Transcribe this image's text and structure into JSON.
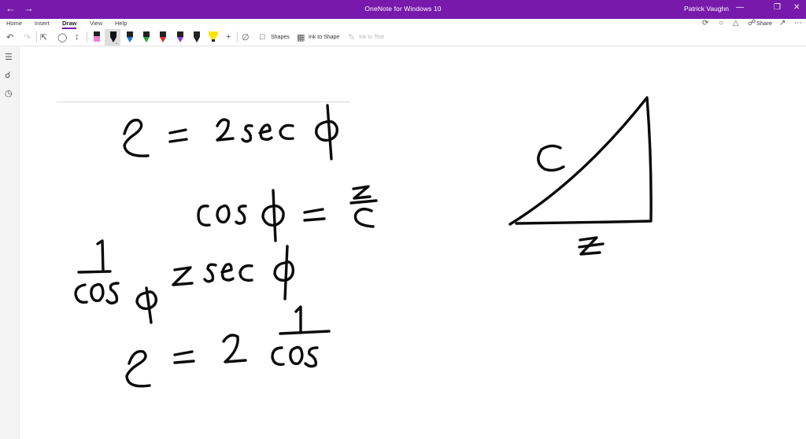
{
  "window": {
    "title": "OneNote for Windows 10",
    "user": "Patrick Vaughn",
    "titlebar_color": "#7719aa"
  },
  "tabs": [
    {
      "label": "Home",
      "active": false
    },
    {
      "label": "Insert",
      "active": false
    },
    {
      "label": "Draw",
      "active": true
    },
    {
      "label": "View",
      "active": false
    },
    {
      "label": "Help",
      "active": false
    }
  ],
  "header_actions": {
    "share_label": "Share",
    "icons": [
      "sync-icon",
      "lightbulb-icon",
      "bell-icon",
      "share-icon",
      "expand-icon",
      "more-icon"
    ]
  },
  "toolbar": {
    "shapes_label": "Shapes",
    "ink_to_shape_label": "Ink to Shape",
    "ink_to_text_label": "Ink to Text",
    "pens": [
      {
        "name": "pink-highlighter",
        "color": "#f47fd4"
      },
      {
        "name": "black-pen",
        "color": "#111111",
        "selected": true
      },
      {
        "name": "blue-pen",
        "color": "#1e74d4"
      },
      {
        "name": "green-pen",
        "color": "#2aa23a"
      },
      {
        "name": "red-pen",
        "color": "#e0262a"
      },
      {
        "name": "purple-pen",
        "color": "#8a3fd1"
      },
      {
        "name": "dark-pen",
        "color": "#222222"
      },
      {
        "name": "yellow-highlighter",
        "color": "#ffe600"
      }
    ]
  },
  "left_rail": {
    "icons": [
      "notebooks-icon",
      "search-icon",
      "recent-icon"
    ]
  }
}
